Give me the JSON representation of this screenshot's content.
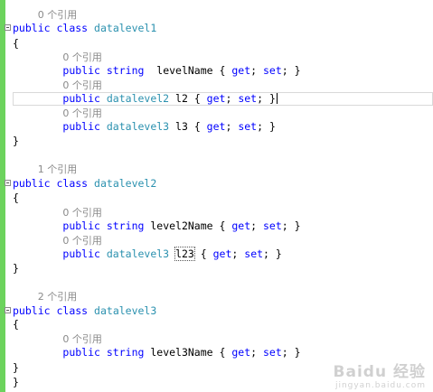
{
  "editor": {
    "colors": {
      "keyword": "#0000ff",
      "type": "#2b91af",
      "reference": "#8a8a8a",
      "changebar": "#6cd35d"
    },
    "lines": [
      {
        "text": "    0 个引用"
      },
      {
        "text": "public class datalevel1",
        "fold": true
      },
      {
        "text": "{"
      },
      {
        "text": "        0 个引用"
      },
      {
        "text": "        public string  levelName { get; set; }"
      },
      {
        "text": "        0 个引用"
      },
      {
        "text": "        public datalevel2 l2 { get; set; }",
        "current": true
      },
      {
        "text": "        0 个引用"
      },
      {
        "text": "        public datalevel3 l3 { get; set; }"
      },
      {
        "text": "}"
      },
      {
        "text": ""
      },
      {
        "text": "    1 个引用"
      },
      {
        "text": "public class datalevel2",
        "fold": true
      },
      {
        "text": "{"
      },
      {
        "text": "        0 个引用"
      },
      {
        "text": "        public string level2Name { get; set; }"
      },
      {
        "text": "        0 个引用"
      },
      {
        "text": "        public datalevel3 l23 { get; set; }"
      },
      {
        "text": "}"
      },
      {
        "text": ""
      },
      {
        "text": "    2 个引用"
      },
      {
        "text": "public class datalevel3",
        "fold": true
      },
      {
        "text": "{"
      },
      {
        "text": "        0 个引用"
      },
      {
        "text": "        public string level3Name { get; set; }"
      },
      {
        "text": "}"
      },
      {
        "text": "}"
      }
    ]
  },
  "watermark": {
    "brand": "Baidu 经验",
    "url": "jingyan.baidu.com"
  }
}
